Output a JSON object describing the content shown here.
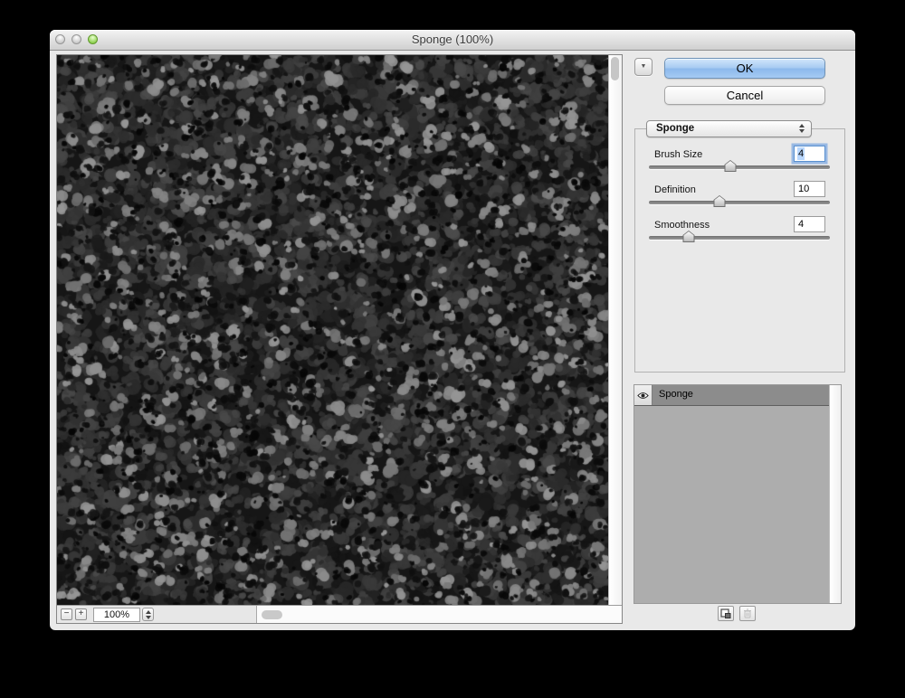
{
  "window": {
    "title": "Sponge (100%)"
  },
  "actions": {
    "ok": "OK",
    "cancel": "Cancel"
  },
  "filter_dropdown": {
    "selected": "Sponge"
  },
  "parameters": {
    "rows": [
      {
        "label": "Brush Size",
        "value": "4",
        "slider_percent": 45,
        "focused": true
      },
      {
        "label": "Definition",
        "value": "10",
        "slider_percent": 39,
        "focused": false
      },
      {
        "label": "Smoothness",
        "value": "4",
        "slider_percent": 22,
        "focused": false
      }
    ]
  },
  "preview": {
    "zoom_level": "100%",
    "zoom_out": "−",
    "zoom_in": "+"
  },
  "effect_layers": {
    "rows": [
      {
        "name": "Sponge",
        "visible": true
      }
    ]
  },
  "icons": {
    "disclosure": "▼"
  },
  "colors": {
    "ok_button_blue": "#9cc3ef",
    "selection_blue": "#b9d7fd",
    "focus_ring_blue": "#6ea0e1",
    "selected_row_gray": "#8c8c8c"
  }
}
